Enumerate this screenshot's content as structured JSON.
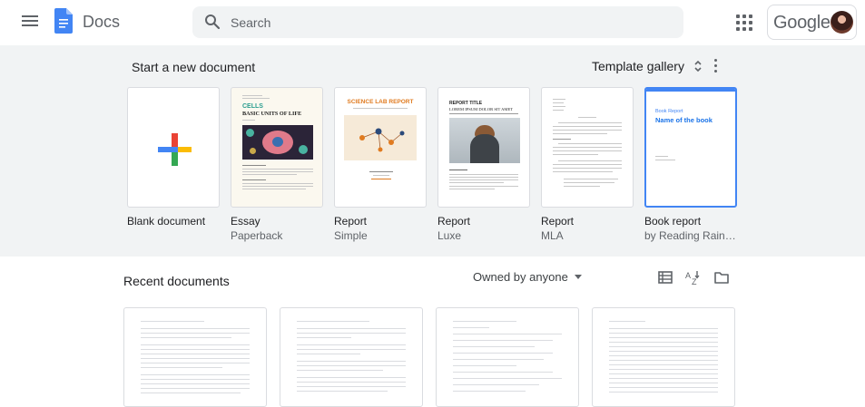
{
  "header": {
    "app_name": "Docs",
    "search_placeholder": "Search",
    "account_brand": "Google"
  },
  "templates": {
    "section_title": "Start a new document",
    "gallery_label": "Template gallery",
    "items": [
      {
        "name": "Blank document",
        "sub": ""
      },
      {
        "name": "Essay",
        "sub": "Paperback",
        "thumb_title": "CELLS",
        "thumb_heading": "BASIC UNITS OF LIFE"
      },
      {
        "name": "Report",
        "sub": "Simple",
        "thumb_heading": "SCIENCE LAB REPORT"
      },
      {
        "name": "Report",
        "sub": "Luxe",
        "thumb_title": "REPORT TITLE",
        "thumb_heading": "LOREM IPSUM DOLOR SIT AMET"
      },
      {
        "name": "Report",
        "sub": "MLA"
      },
      {
        "name": "Book report",
        "sub": "by Reading Rainbo...",
        "thumb_title": "Book Report",
        "thumb_heading": "Name of the book"
      }
    ]
  },
  "recent": {
    "title": "Recent documents",
    "owner_filter": "Owned by anyone"
  },
  "colors": {
    "accent": "#4285f4",
    "essay_title": "#2a9d8f",
    "simple_heading": "#e07b20"
  },
  "icons": {
    "menu": "hamburger-icon",
    "search": "search-icon",
    "apps": "apps-grid-icon",
    "sort": "sort-az-icon",
    "list_view": "list-view-icon",
    "folder": "folder-icon"
  }
}
